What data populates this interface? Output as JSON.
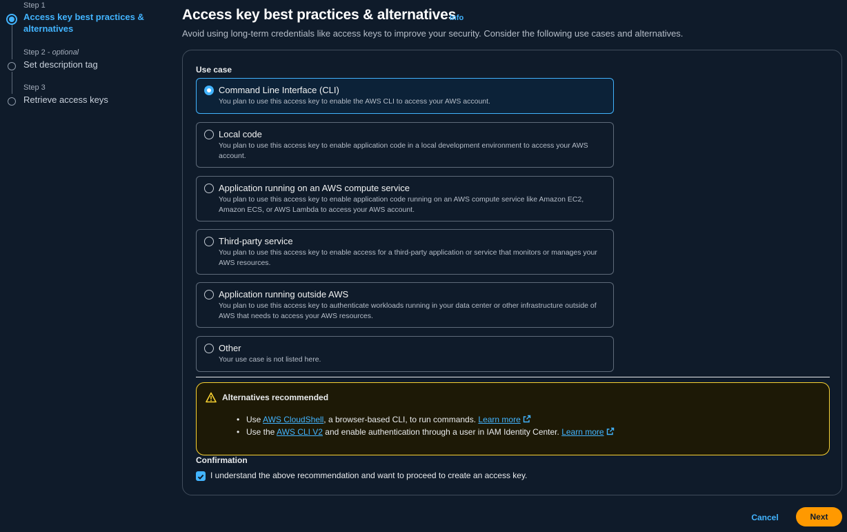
{
  "stepper": {
    "steps": [
      {
        "num": "Step 1",
        "title": "Access key best practices & alternatives"
      },
      {
        "num": "Step 2",
        "optional": "optional",
        "title": "Set description tag"
      },
      {
        "num": "Step 3",
        "title": "Retrieve access keys"
      }
    ]
  },
  "header": {
    "title": "Access key best practices & alternatives",
    "info": "Info",
    "subtitle": "Avoid using long-term credentials like access keys to improve your security. Consider the following use cases and alternatives."
  },
  "use_case": {
    "label": "Use case",
    "selected": "Command Line Interface (CLI)",
    "options": [
      {
        "title": "Command Line Interface (CLI)",
        "desc": "You plan to use this access key to enable the AWS CLI to access your AWS account."
      },
      {
        "title": "Local code",
        "desc": "You plan to use this access key to enable application code in a local development environment to access your AWS account."
      },
      {
        "title": "Application running on an AWS compute service",
        "desc": "You plan to use this access key to enable application code running on an AWS compute service like Amazon EC2, Amazon ECS, or AWS Lambda to access your AWS account."
      },
      {
        "title": "Third-party service",
        "desc": "You plan to use this access key to enable access for a third-party application or service that monitors or manages your AWS resources."
      },
      {
        "title": "Application running outside AWS",
        "desc": "You plan to use this access key to authenticate workloads running in your data center or other infrastructure outside of AWS that needs to access your AWS resources."
      },
      {
        "title": "Other",
        "desc": "Your use case is not listed here."
      }
    ]
  },
  "alert": {
    "title": "Alternatives recommended",
    "item1": {
      "pre": "Use ",
      "link": "AWS CloudShell",
      "post": ", a browser-based CLI, to run commands. ",
      "learn": "Learn more"
    },
    "item2": {
      "pre": "Use the ",
      "link": "AWS CLI V2",
      "post": " and enable authentication through a user in IAM Identity Center. ",
      "learn": "Learn more"
    }
  },
  "confirmation": {
    "label": "Confirmation",
    "checked": true,
    "text": "I understand the above recommendation and want to proceed to create an access key."
  },
  "footer": {
    "cancel": "Cancel",
    "next": "Next"
  },
  "colors": {
    "background": "#0f1b2a",
    "accent": "#42b4ff",
    "primary_button": "#ff9900",
    "warning_border": "#fbd332"
  },
  "icons": [
    "radio-selected-icon",
    "radio-icon",
    "warning-icon",
    "external-link-icon",
    "checkbox-checked-icon"
  ]
}
